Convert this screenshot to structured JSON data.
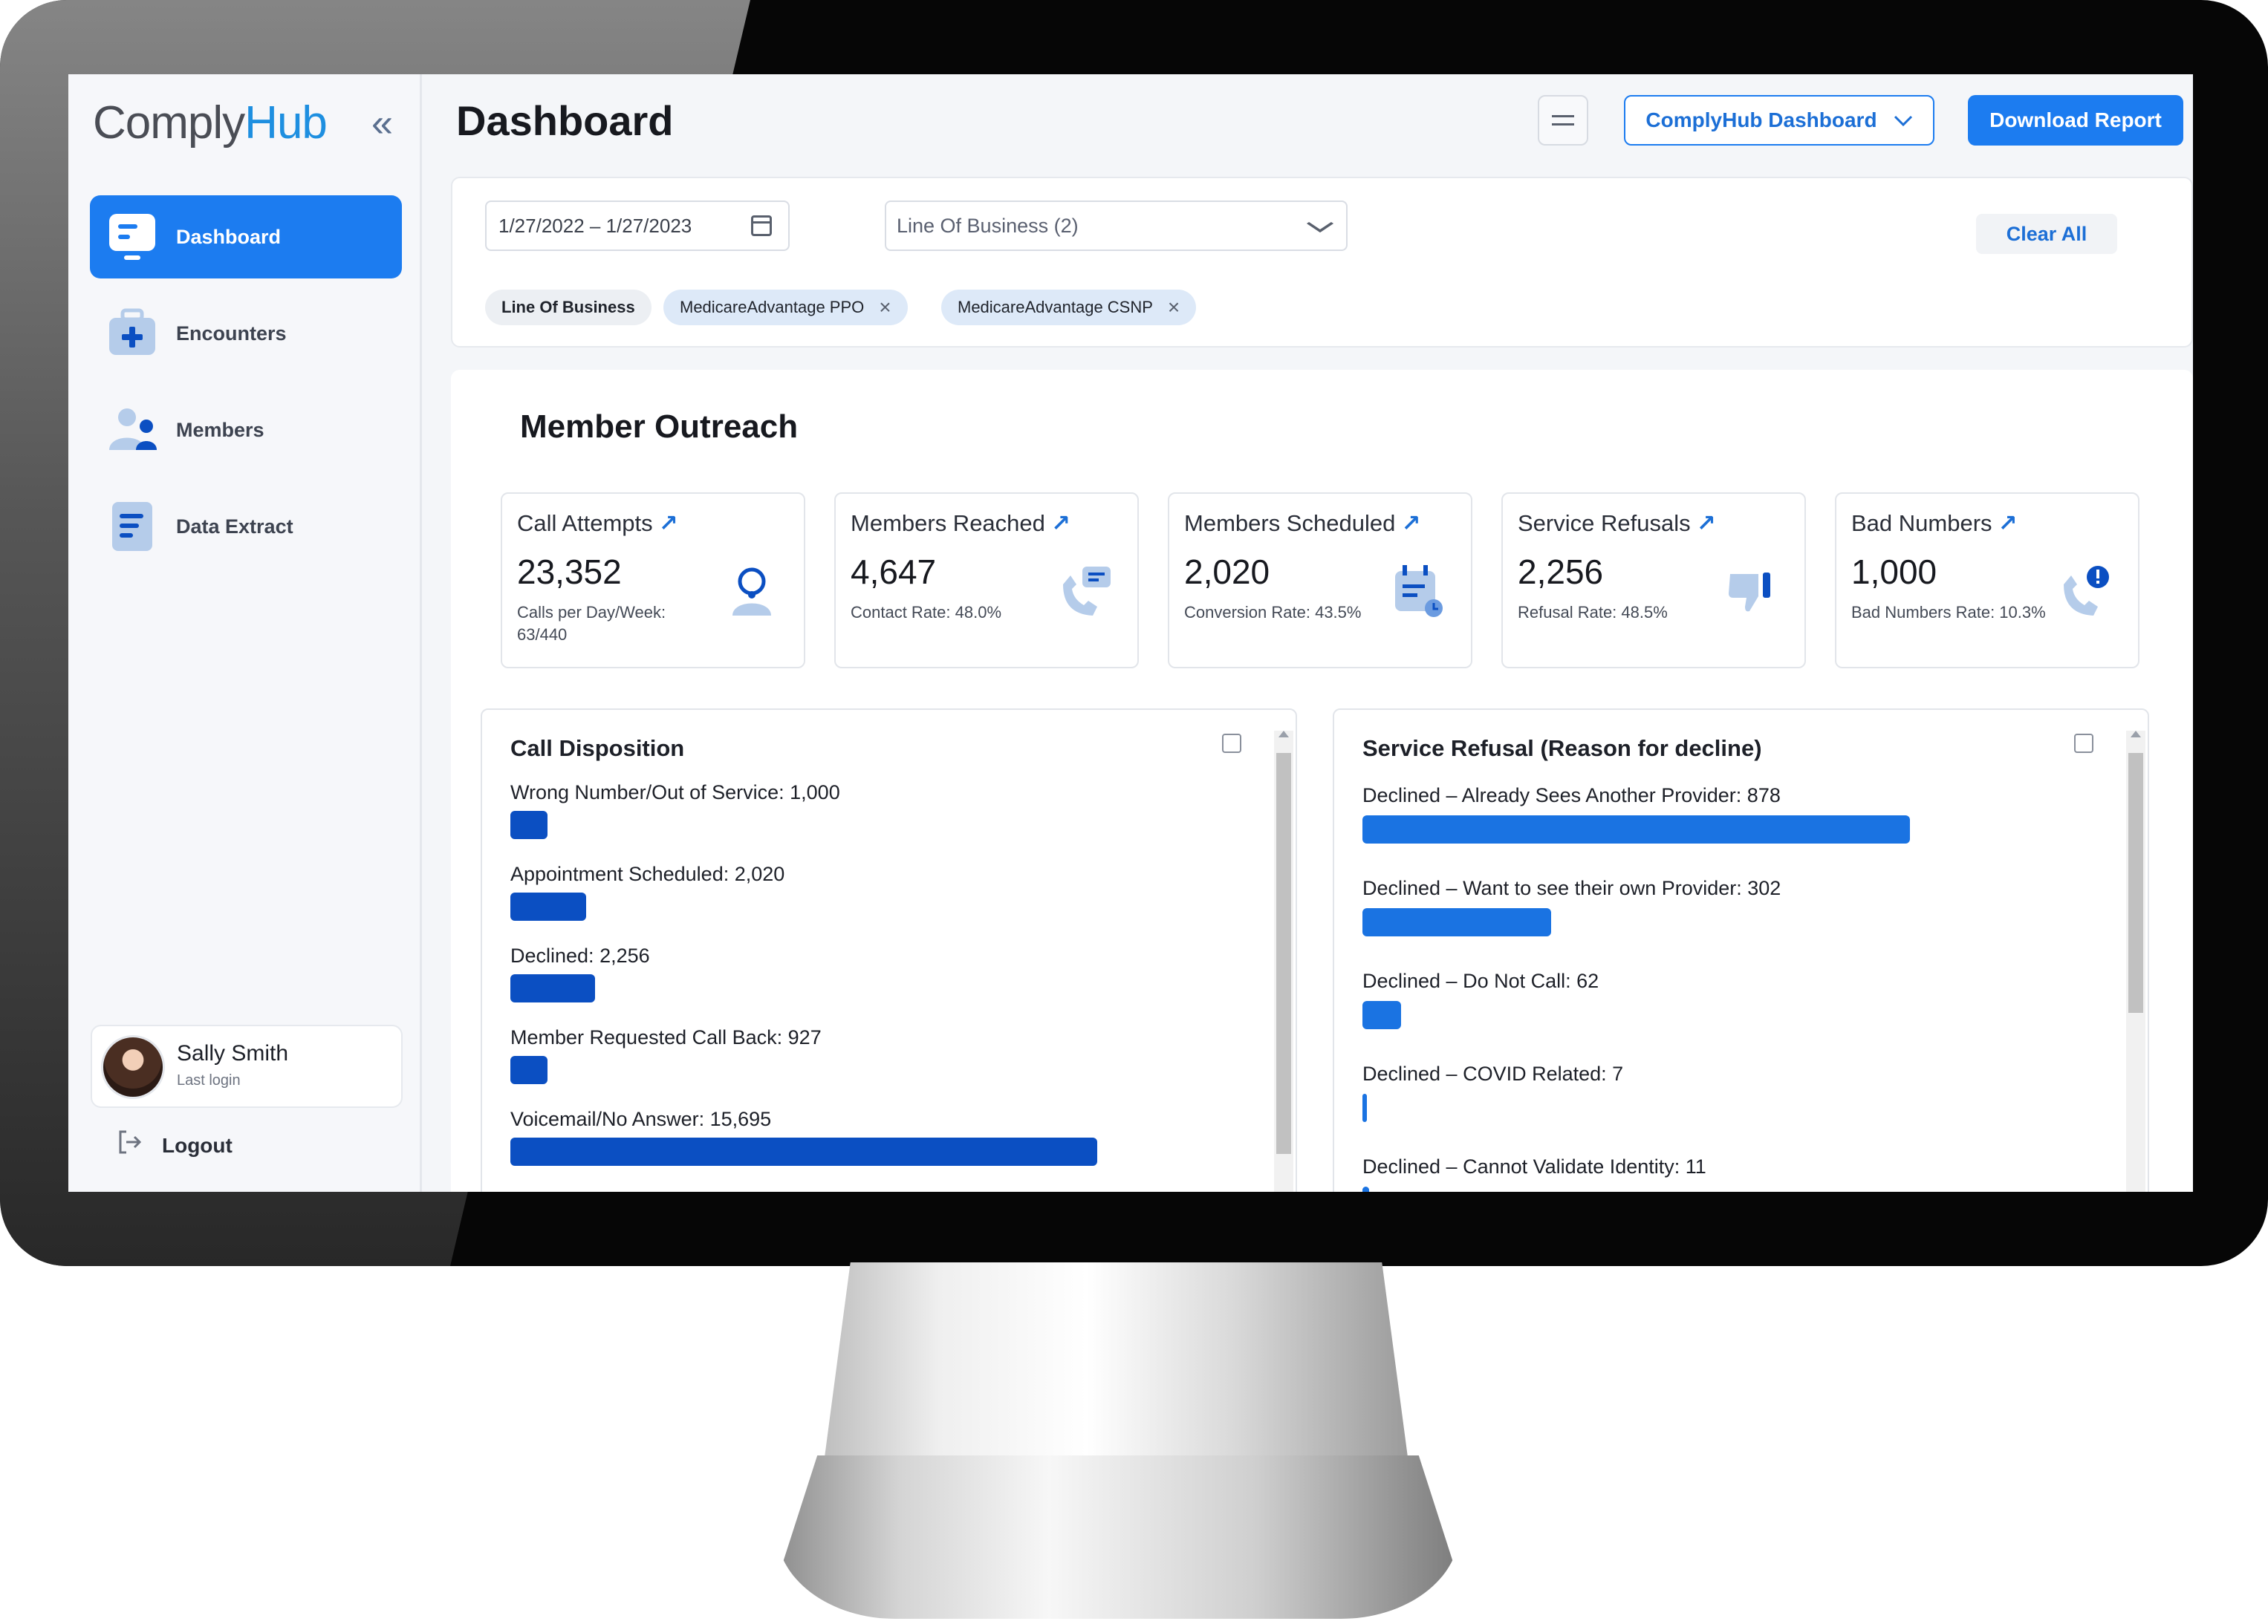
{
  "app": {
    "logo_part1": "Comply",
    "logo_part2": "Hub",
    "collapse_icon": "«"
  },
  "sidebar": {
    "items": [
      {
        "label": "Dashboard",
        "icon": "dashboard-icon",
        "active": true
      },
      {
        "label": "Encounters",
        "icon": "medical-bag-icon",
        "active": false
      },
      {
        "label": "Members",
        "icon": "members-icon",
        "active": false
      },
      {
        "label": "Data Extract",
        "icon": "document-icon",
        "active": false
      }
    ],
    "user": {
      "name": "Sally Smith",
      "subtitle": "Last login"
    },
    "logout_label": "Logout"
  },
  "header": {
    "title": "Dashboard",
    "dashboard_select": "ComplyHub Dashboard",
    "download_label": "Download Report"
  },
  "filters": {
    "date_range": "1/27/2022 – 1/27/2023",
    "line_of_business": "Line Of Business (2)",
    "clear_all": "Clear All",
    "chip_label": "Line Of Business",
    "chips": [
      "MedicareAdvantage PPO",
      "MedicareAdvantage CSNP"
    ]
  },
  "outreach": {
    "title": "Member Outreach",
    "cards": [
      {
        "title": "Call Attempts",
        "value": "23,352",
        "sub": "Calls per Day/Week: 63/440",
        "icon": "headset-agent-icon"
      },
      {
        "title": "Members Reached",
        "value": "4,647",
        "sub": "Contact Rate: 48.0%",
        "icon": "phone-chat-icon"
      },
      {
        "title": "Members Scheduled",
        "value": "2,020",
        "sub": "Conversion Rate: 43.5%",
        "icon": "calendar-clock-icon"
      },
      {
        "title": "Service Refusals",
        "value": "2,256",
        "sub": "Refusal Rate: 48.5%",
        "icon": "thumbs-down-icon"
      },
      {
        "title": "Bad Numbers",
        "value": "1,000",
        "sub": "Bad Numbers Rate: 10.3%",
        "icon": "phone-alert-icon"
      }
    ]
  },
  "colors": {
    "accent": "#1c7cf0",
    "bar_dark": "#0b4fc2",
    "bar_light": "#1a73e2"
  },
  "chart_data": [
    {
      "type": "bar",
      "title": "Call Disposition",
      "categories": [
        "Wrong Number/Out of Service",
        "Appointment Scheduled",
        "Declined",
        "Member Requested Call Back",
        "Voicemail/No Answer"
      ],
      "labels": [
        "Wrong Number/Out of Service: 1,000",
        "Appointment Scheduled: 2,020",
        "Declined: 2,256",
        "Member Requested Call Back: 927",
        "Voicemail/No Answer: 15,695"
      ],
      "values": [
        1000,
        2020,
        2256,
        927,
        15695
      ]
    },
    {
      "type": "bar",
      "title": "Service Refusal (Reason for decline)",
      "categories": [
        "Declined – Already Sees Another Provider",
        "Declined – Want to see their own Provider",
        "Declined – Do Not Call",
        "Declined – COVID Related",
        "Declined – Cannot Validate Identity"
      ],
      "labels": [
        "Declined – Already Sees Another Provider: 878",
        "Declined – Want to see their own Provider: 302",
        "Declined – Do Not Call: 62",
        "Declined – COVID Related: 7",
        "Declined – Cannot Validate Identity: 11"
      ],
      "values": [
        878,
        302,
        62,
        7,
        11
      ]
    }
  ]
}
